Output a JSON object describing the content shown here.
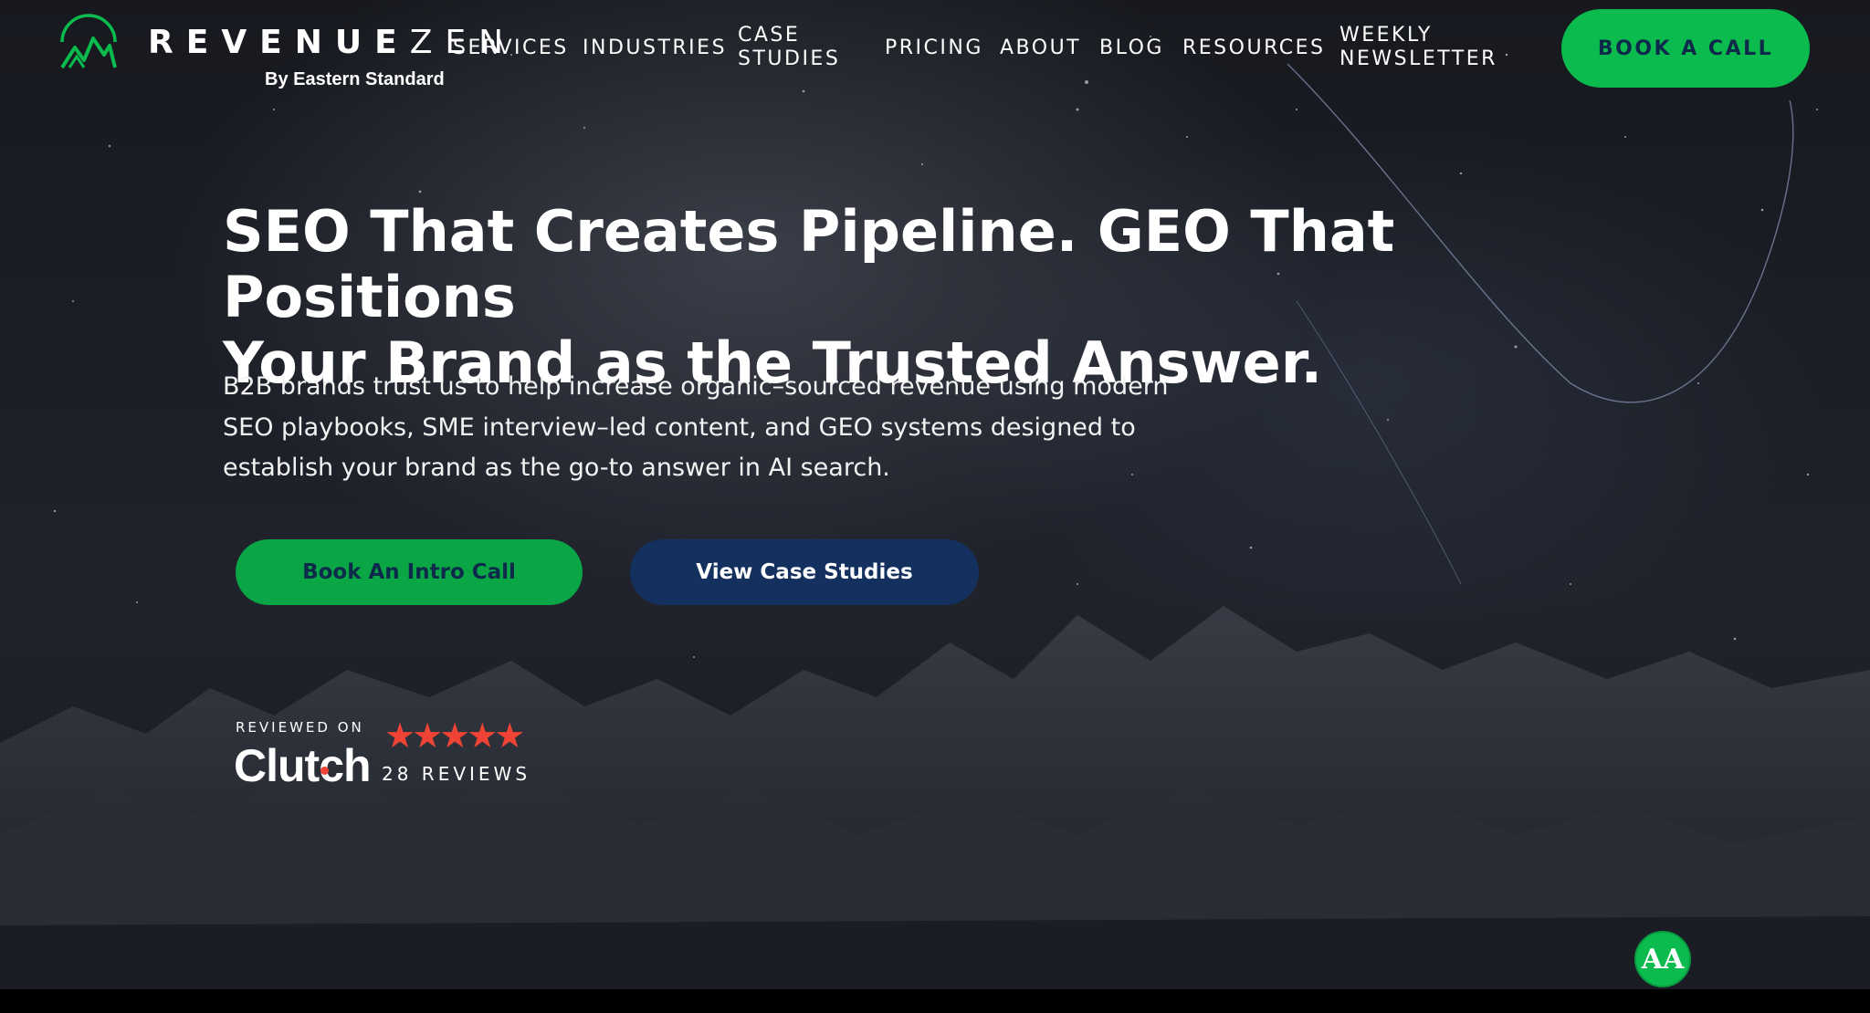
{
  "brand": {
    "name_bold": "REVENUE",
    "name_light": "ZEN",
    "tagline": "By Eastern Standard",
    "accent_color": "#0bbb4e",
    "navy_color": "#13305e"
  },
  "nav": {
    "items": [
      {
        "label": "SERVICES"
      },
      {
        "label": "INDUSTRIES"
      },
      {
        "label": "CASE STUDIES"
      },
      {
        "label": "PRICING"
      },
      {
        "label": "ABOUT"
      },
      {
        "label": "BLOG"
      },
      {
        "label": "RESOURCES"
      },
      {
        "label": "WEEKLY NEWSLETTER"
      }
    ],
    "cta_label": "BOOK A CALL"
  },
  "hero": {
    "headline_line1": "SEO That Creates Pipeline. GEO That Positions",
    "headline_line2": "Your Brand as the Trusted Answer.",
    "subtext": "B2B brands trust us to help increase organic–sourced revenue using modern SEO playbooks, SME interview–led content, and GEO systems designed to establish your brand as the go-to answer in AI search.",
    "primary_cta": "Book An Intro Call",
    "secondary_cta": "View Case Studies"
  },
  "clutch": {
    "reviewed_on": "REVIEWED ON",
    "brand": "Clutch",
    "rating": 5,
    "stars": "★★★★★",
    "reviews": "28 REVIEWS"
  },
  "accessibility": {
    "icon": "accessibility-icon",
    "label": "AA"
  }
}
